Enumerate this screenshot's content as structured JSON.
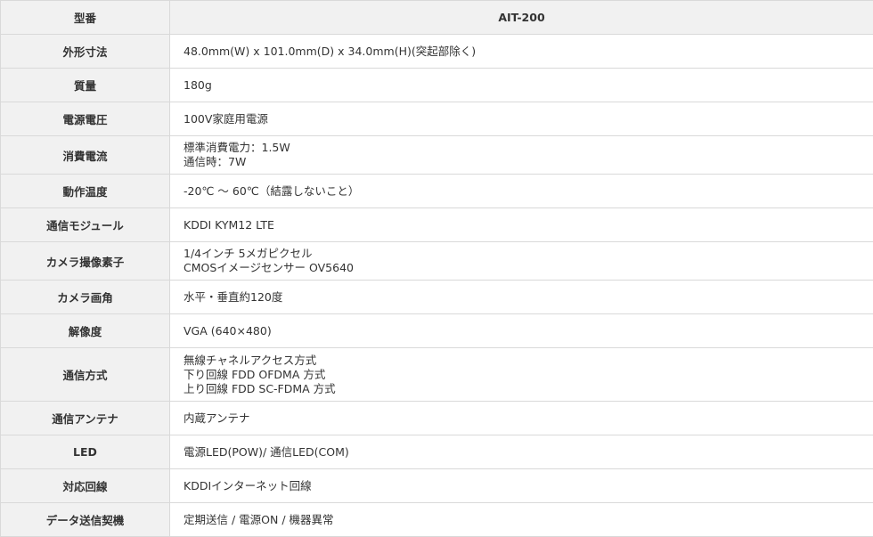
{
  "header": {
    "label": "型番",
    "value": "AIT-200"
  },
  "rows": [
    {
      "label": "外形寸法",
      "lines": [
        "48.0mm(W) x 101.0mm(D) x 34.0mm(H)(突起部除く)"
      ]
    },
    {
      "label": "質量",
      "lines": [
        "180g"
      ]
    },
    {
      "label": "電源電圧",
      "lines": [
        "100V家庭用電源"
      ]
    },
    {
      "label": "消費電流",
      "lines": [
        "標準消費電力：1.5W",
        "通信時：7W"
      ]
    },
    {
      "label": "動作温度",
      "lines": [
        "-20℃ 〜 60℃（結露しないこと）"
      ]
    },
    {
      "label": "通信モジュール",
      "lines": [
        "KDDI KYM12 LTE"
      ]
    },
    {
      "label": "カメラ撮像素子",
      "lines": [
        "1/4インチ 5メガピクセル",
        "CMOSイメージセンサー OV5640"
      ]
    },
    {
      "label": "カメラ画角",
      "lines": [
        "水平・垂直約120度"
      ]
    },
    {
      "label": "解像度",
      "lines": [
        "VGA (640×480)"
      ]
    },
    {
      "label": "通信方式",
      "lines": [
        "無線チャネルアクセス方式",
        "下り回線 FDD OFDMA 方式",
        "上り回線 FDD SC-FDMA 方式"
      ]
    },
    {
      "label": "通信アンテナ",
      "lines": [
        "内蔵アンテナ"
      ]
    },
    {
      "label": "LED",
      "lines": [
        "電源LED(POW)/ 通信LED(COM)"
      ]
    },
    {
      "label": "対応回線",
      "lines": [
        "KDDIインターネット回線"
      ]
    },
    {
      "label": "データ送信契機",
      "lines": [
        "定期送信 / 電源ON / 機器異常"
      ]
    }
  ]
}
